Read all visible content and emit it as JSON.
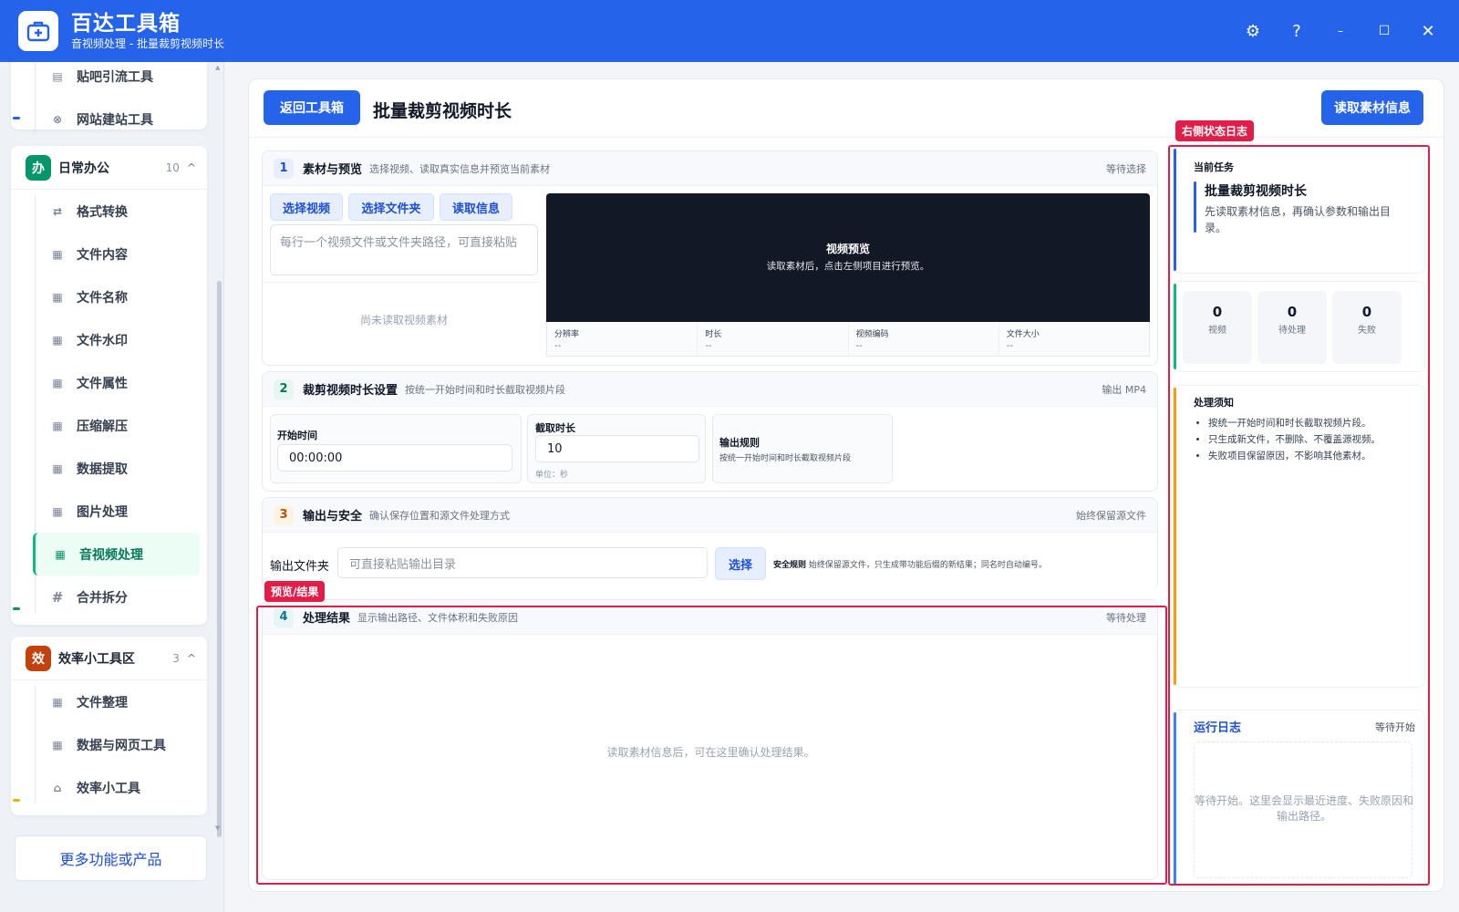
{
  "app": {
    "title": "百达工具箱",
    "subtitle": "音视频处理 - 批量裁剪视频时长"
  },
  "window_controls": {
    "settings_icon": "⚙",
    "help_icon": "?",
    "minimize_icon": "–",
    "maximize_icon": "☐",
    "close_icon": "✕"
  },
  "sidebar": {
    "top_items": [
      {
        "label": "贴吧引流工具",
        "icon": "▤"
      },
      {
        "label": "网站建站工具",
        "icon": "⊗"
      }
    ],
    "groups": [
      {
        "badge": "办",
        "name": "日常办公",
        "count": "10",
        "caret": "^",
        "color": "#059669",
        "items": [
          {
            "label": "格式转换",
            "icon": "⇄"
          },
          {
            "label": "文件内容",
            "icon": "▦"
          },
          {
            "label": "文件名称",
            "icon": "▦"
          },
          {
            "label": "文件水印",
            "icon": "▦"
          },
          {
            "label": "文件属性",
            "icon": "▦"
          },
          {
            "label": "压缩解压",
            "icon": "▦"
          },
          {
            "label": "数据提取",
            "icon": "▦"
          },
          {
            "label": "图片处理",
            "icon": "▦"
          },
          {
            "label": "音视频处理",
            "icon": "▦",
            "active": true
          },
          {
            "label": "合并拆分",
            "icon": "#"
          }
        ]
      },
      {
        "badge": "效",
        "name": "效率小工具区",
        "count": "3",
        "caret": "^",
        "color": "#c2410c",
        "items": [
          {
            "label": "文件整理",
            "icon": "▦"
          },
          {
            "label": "数据与网页工具",
            "icon": "▦"
          },
          {
            "label": "效率小工具",
            "icon": "⌂"
          }
        ]
      }
    ],
    "more_button": "更多功能或产品"
  },
  "header": {
    "back_button": "返回工具箱",
    "page_title": "批量裁剪视频时长",
    "read_info_button": "读取素材信息"
  },
  "sections": {
    "s1": {
      "num": "1",
      "title": "素材与预览",
      "desc": "选择视频、读取真实信息并预览当前素材",
      "status": "等待选择",
      "buttons": [
        "选择视频",
        "选择文件夹",
        "读取信息"
      ],
      "path_placeholder": "每行一个视频文件或文件夹路径，可直接粘贴",
      "empty_text": "尚未读取视频素材",
      "preview_title": "视频预览",
      "preview_hint": "读取素材后，点击左侧项目进行预览。",
      "meta": [
        {
          "label": "分辨率",
          "value": "--"
        },
        {
          "label": "时长",
          "value": "--"
        },
        {
          "label": "视频编码",
          "value": "--"
        },
        {
          "label": "文件大小",
          "value": "--"
        }
      ]
    },
    "s2": {
      "num": "2",
      "title": "裁剪视频时长设置",
      "desc": "按统一开始时间和时长截取视频片段",
      "status": "输出 MP4",
      "start_label": "开始时间",
      "start_value": "00:00:00",
      "duration_label": "截取时长",
      "duration_value": "10",
      "duration_unit": "单位：秒",
      "rule_title": "输出规则",
      "rule_desc": "按统一开始时间和时长截取视频片段"
    },
    "s3": {
      "num": "3",
      "title": "输出与安全",
      "desc": "确认保存位置和源文件处理方式",
      "status": "始终保留源文件",
      "folder_label": "输出文件夹",
      "folder_placeholder": "可直接粘贴输出目录",
      "choose_button": "选择",
      "safety_title": "安全规则",
      "safety_desc": "始终保留源文件，只生成带功能后缀的新结果；同名时自动编号。"
    },
    "s4": {
      "num": "4",
      "title": "处理结果",
      "desc": "显示输出路径、文件体积和失败原因",
      "status": "等待处理",
      "empty_text": "读取素材信息后，可在这里确认处理结果。"
    }
  },
  "right_panel": {
    "task_label": "当前任务",
    "task_title": "批量裁剪视频时长",
    "task_desc": "先读取素材信息，再确认参数和输出目录。",
    "stats": [
      {
        "num": "0",
        "label": "视频"
      },
      {
        "num": "0",
        "label": "待处理"
      },
      {
        "num": "0",
        "label": "失败"
      }
    ],
    "notes_title": "处理须知",
    "notes": [
      "按统一开始时间和时长截取视频片段。",
      "只生成新文件，不删除、不覆盖源视频。",
      "失败项目保留原因，不影响其他素材。"
    ],
    "log_title": "运行日志",
    "log_status": "等待开始",
    "log_placeholder": "等待开始。这里会显示最近进度、失败原因和输出路径。"
  },
  "annotations": {
    "right_tag": "右侧状态日志",
    "result_tag": "预览/结果"
  },
  "colors": {
    "brand": "#2563eb",
    "active_green": "#10b981",
    "annotation_red": "#e11d48"
  }
}
